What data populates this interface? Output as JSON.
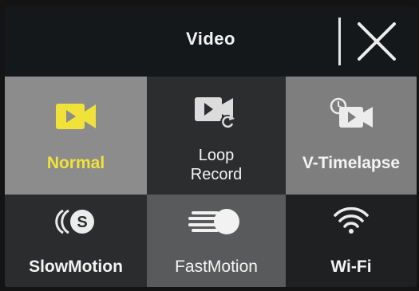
{
  "header": {
    "title": "Video",
    "close_icon": "close-icon"
  },
  "colors": {
    "accent_selected": "#f1e23a",
    "tile_normal": "#8a8a8a",
    "tile_highlight": "#5a5b5c",
    "tile_dark": "#2a2c2e",
    "text": "#f4f4f4"
  },
  "modes": [
    {
      "label": "Normal",
      "icon": "video-camera-icon",
      "state": "selected"
    },
    {
      "label_line1": "Loop",
      "label_line2": "Record",
      "icon": "loop-record-icon"
    },
    {
      "label": "V-Timelapse",
      "icon": "timelapse-camera-icon"
    },
    {
      "label": "SlowMotion",
      "icon": "slow-motion-icon"
    },
    {
      "label": "FastMotion",
      "icon": "fast-motion-icon"
    },
    {
      "label": "Wi-Fi",
      "icon": "wifi-icon"
    }
  ]
}
